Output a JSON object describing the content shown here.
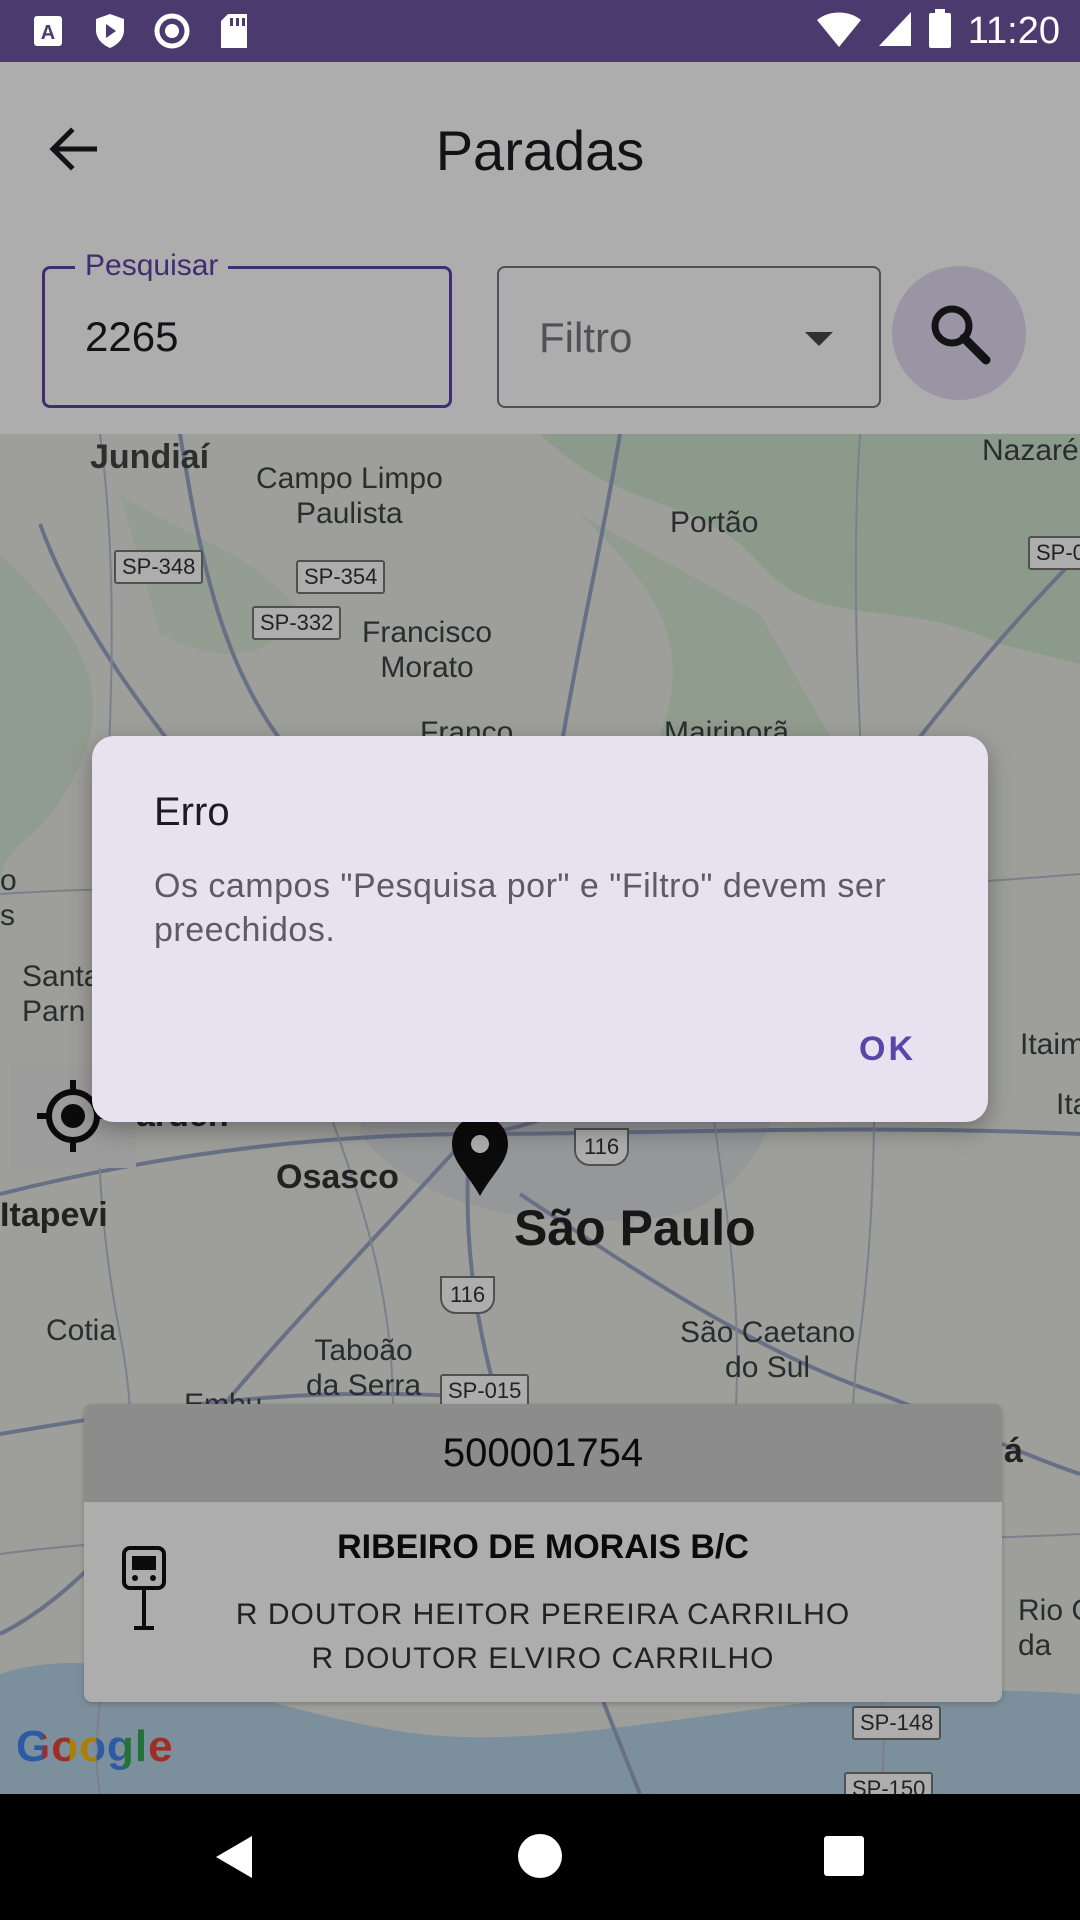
{
  "status_bar": {
    "time": "11:20",
    "icons": [
      "app-notification-icon",
      "play-protect-icon",
      "record-icon",
      "sd-card-icon",
      "wifi-icon",
      "signal-icon",
      "battery-icon"
    ]
  },
  "app_bar": {
    "title": "Paradas",
    "back_icon": "arrow-back-icon"
  },
  "search": {
    "pesquisar_label": "Pesquisar",
    "pesquisar_value": "2265",
    "filtro_placeholder": "Filtro",
    "search_icon": "search-icon"
  },
  "map": {
    "labels": {
      "jundiai": "Jundiaí",
      "campo_limpo": "Campo Limpo\nPaulista",
      "portao": "Portão",
      "nazare": "Nazaré",
      "francisco_morato": "Francisco\nMorato",
      "franco": "Franco",
      "mairipora": "Mairiporã",
      "santana": "Santa\nParn",
      "jardem": "arden",
      "itaim": "Itaim P",
      "ita": "Ita",
      "osasco": "Osasco",
      "sao_paulo": "São Paulo",
      "itapevi": "Itapevi",
      "cotia": "Cotia",
      "taboao": "Taboão\nda Serra",
      "sao_caetano": "São Caetano\ndo Sul",
      "embu": "Embu",
      "rio": "Rio G\nda",
      "a": "á",
      "os": "o\ns"
    },
    "road_badges": {
      "sp348": "SP-348",
      "sp354": "SP-354",
      "sp332": "SP-332",
      "sp0": "SP-0",
      "sp015": "SP-015",
      "sp148": "SP-148",
      "sp150": "SP-150"
    },
    "route_badges": {
      "r116a": "116",
      "r116b": "116"
    },
    "attribution": "Google"
  },
  "stop_card": {
    "code": "500001754",
    "name": "RIBEIRO DE MORAIS B/C",
    "address_line1": "R DOUTOR HEITOR PEREIRA CARRILHO",
    "address_line2": "R DOUTOR ELVIRO CARRILHO"
  },
  "dialog": {
    "title": "Erro",
    "message": "Os campos \"Pesquisa por\" e \"Filtro\" devem ser preechidos.",
    "ok_label": "OK"
  },
  "colors": {
    "status_bar": "#4a3a6e",
    "accent": "#5b45a8",
    "dialog_bg": "#e8e1ef",
    "search_btn_bg": "#e3dcf3"
  }
}
